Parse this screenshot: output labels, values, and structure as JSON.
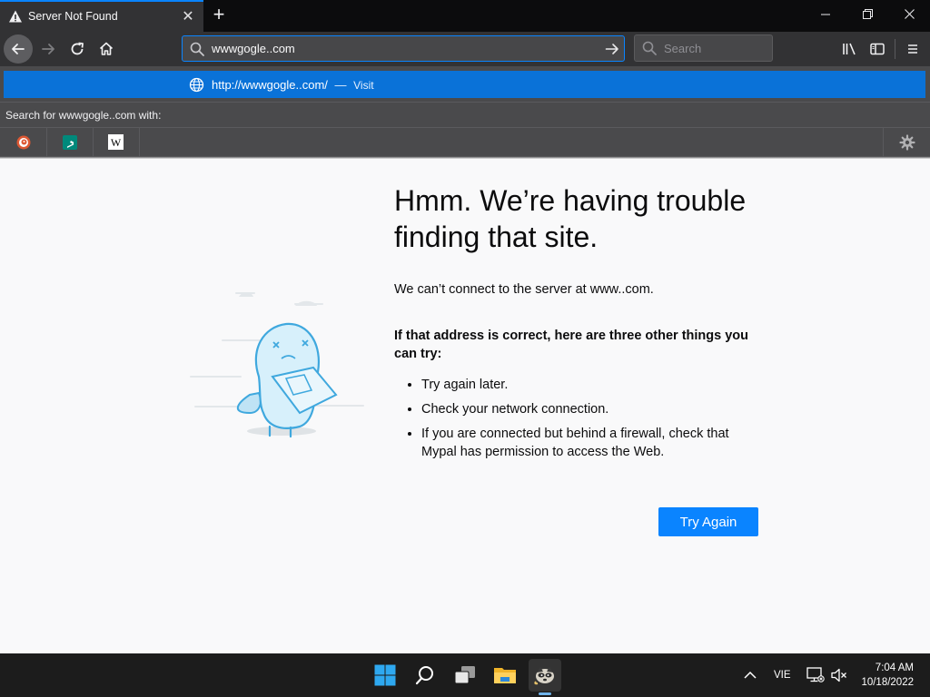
{
  "tab": {
    "title": "Server Not Found"
  },
  "navbar": {
    "url_value": "wwwgogle..com",
    "search_placeholder": "Search"
  },
  "popup": {
    "suggestion_url": "http://wwwgogle..com/",
    "suggestion_sep": "—",
    "suggestion_action": "Visit",
    "search_with_label": "Search for wwwgogle..com with:",
    "engines": [
      "duckduckgo-icon",
      "bing-icon",
      "wikipedia-icon"
    ]
  },
  "error_page": {
    "title": "Hmm. We’re having trouble finding that site.",
    "description": "We can’t connect to the server at www..com.",
    "try_title": "If that address is correct, here are three other things you can try:",
    "suggestions": [
      "Try again later.",
      "Check your network connection.",
      "If you are connected but behind a firewall, check that Mypal has permission to access the Web."
    ],
    "try_again_label": "Try Again"
  },
  "taskbar": {
    "language": "VIE",
    "time": "7:04 AM",
    "date": "10/18/2022"
  },
  "colors": {
    "accent": "#0a84ff",
    "popup_highlight": "#0a72d8",
    "chrome_dark": "#323234"
  }
}
